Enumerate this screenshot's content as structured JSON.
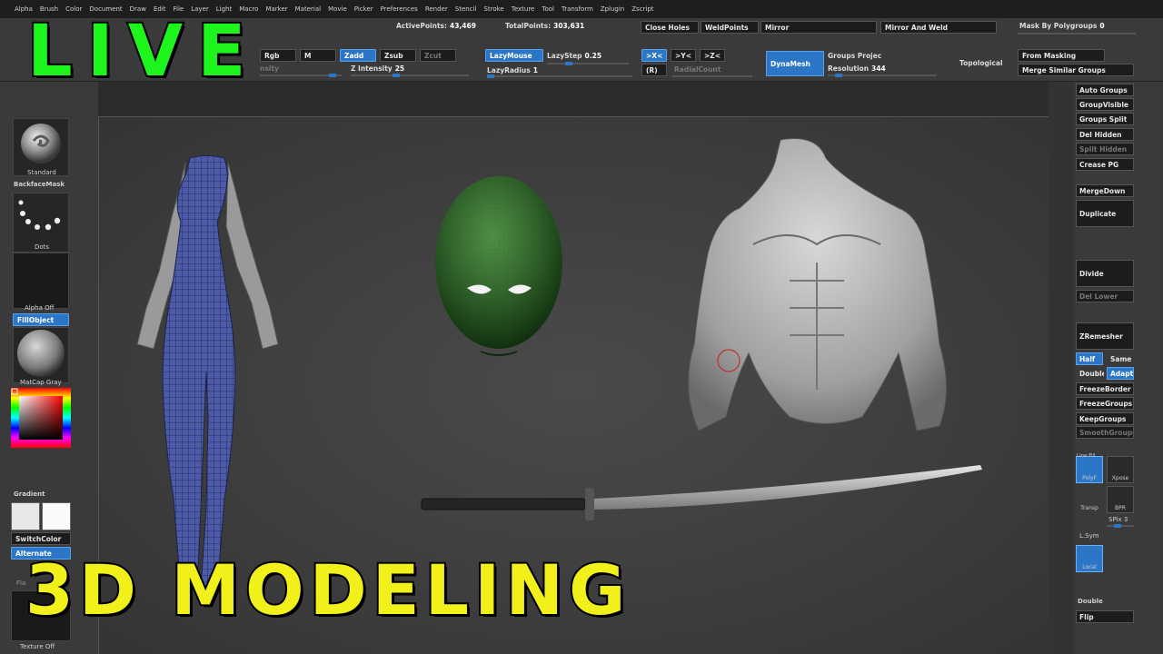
{
  "menu": [
    "Alpha",
    "Brush",
    "Color",
    "Document",
    "Draw",
    "Edit",
    "File",
    "Layer",
    "Light",
    "Macro",
    "Marker",
    "Material",
    "Movie",
    "Picker",
    "Preferences",
    "Render",
    "Stencil",
    "Stroke",
    "Texture",
    "Tool",
    "Transform",
    "Zplugin",
    "Zscript"
  ],
  "stats": {
    "active_label": "ActivePoints:",
    "active_value": "43,469",
    "total_label": "TotalPoints:",
    "total_value": "303,631"
  },
  "top": {
    "rgb": "Rgb",
    "m": "M",
    "zadd": "Zadd",
    "zsub": "Zsub",
    "zcut": "Zcut",
    "intensity_label": "Z Intensity",
    "intensity_value": "25",
    "density": "nsity",
    "lazymouse": "LazyMouse",
    "lazystep_label": "LazyStep",
    "lazystep_value": "0.25",
    "lazyradius_label": "LazyRadius",
    "lazyradius_value": "1",
    "x_sym": ">X<",
    "y_sym": ">Y<",
    "z_sym": ">Z<",
    "r_sym": "(R)",
    "radialcount": "RadialCount",
    "dynamesh": "DynaMesh",
    "groups_projec": "Groups Projec",
    "resolution_label": "Resolution",
    "resolution_value": "344",
    "topological": "Topological",
    "close_holes": "Close Holes",
    "weldpoints": "WeldPoints",
    "mirror": "Mirror",
    "mirror_weld": "Mirror And Weld",
    "mask_polygroups_label": "Mask By Polygroups",
    "mask_polygroups_value": "0",
    "from_masking": "From Masking",
    "merge_similar": "Merge Similar Groups"
  },
  "left": {
    "standard": "Standard",
    "backfacemask": "BackfaceMask",
    "dots": "Dots",
    "alpha_off": "Alpha Off",
    "fillobject": "FillObject",
    "matcap": "MatCap Gray",
    "gradient": "Gradient",
    "switchcolor": "SwitchColor",
    "alternate": "Alternate",
    "texture_off": "Texture Off",
    "flat": "Fla"
  },
  "right": {
    "auto_groups": "Auto Groups",
    "groupvisible": "GroupVisible",
    "groups_split": "Groups Split",
    "del_hidden": "Del Hidden",
    "split_hidden": "Split Hidden",
    "crease_pg": "Crease PG",
    "mergedown": "MergeDown",
    "duplicate": "Duplicate",
    "divide": "Divide",
    "del_lower": "Del Lower",
    "zremesher": "ZRemesher",
    "half": "Half",
    "same": "Same",
    "double": "Double",
    "adapt": "Adapt",
    "freezeborder": "FreezeBorder",
    "freezegroups": "FreezeGroups",
    "keepgroups": "KeepGroups",
    "smoothgroups": "SmoothGroups",
    "polyf": "PolyF",
    "xpose": "Xpose",
    "transp": "Transp",
    "bpr": "BPR",
    "spix_label": "SPix",
    "spix_value": "3",
    "lsym": "L.Sym",
    "local": "Local",
    "line_fill": "Line Fill",
    "double2": "Double",
    "flip": "Flip"
  },
  "overlay": {
    "live": "LIVE",
    "modeling": "3D MODELING"
  },
  "colors": {
    "accent": "#2b76c6",
    "live": "#1df51d",
    "title": "#f2f01a",
    "body_mesh": "#4d5aa8",
    "head_mesh": "#2f6b2a"
  }
}
